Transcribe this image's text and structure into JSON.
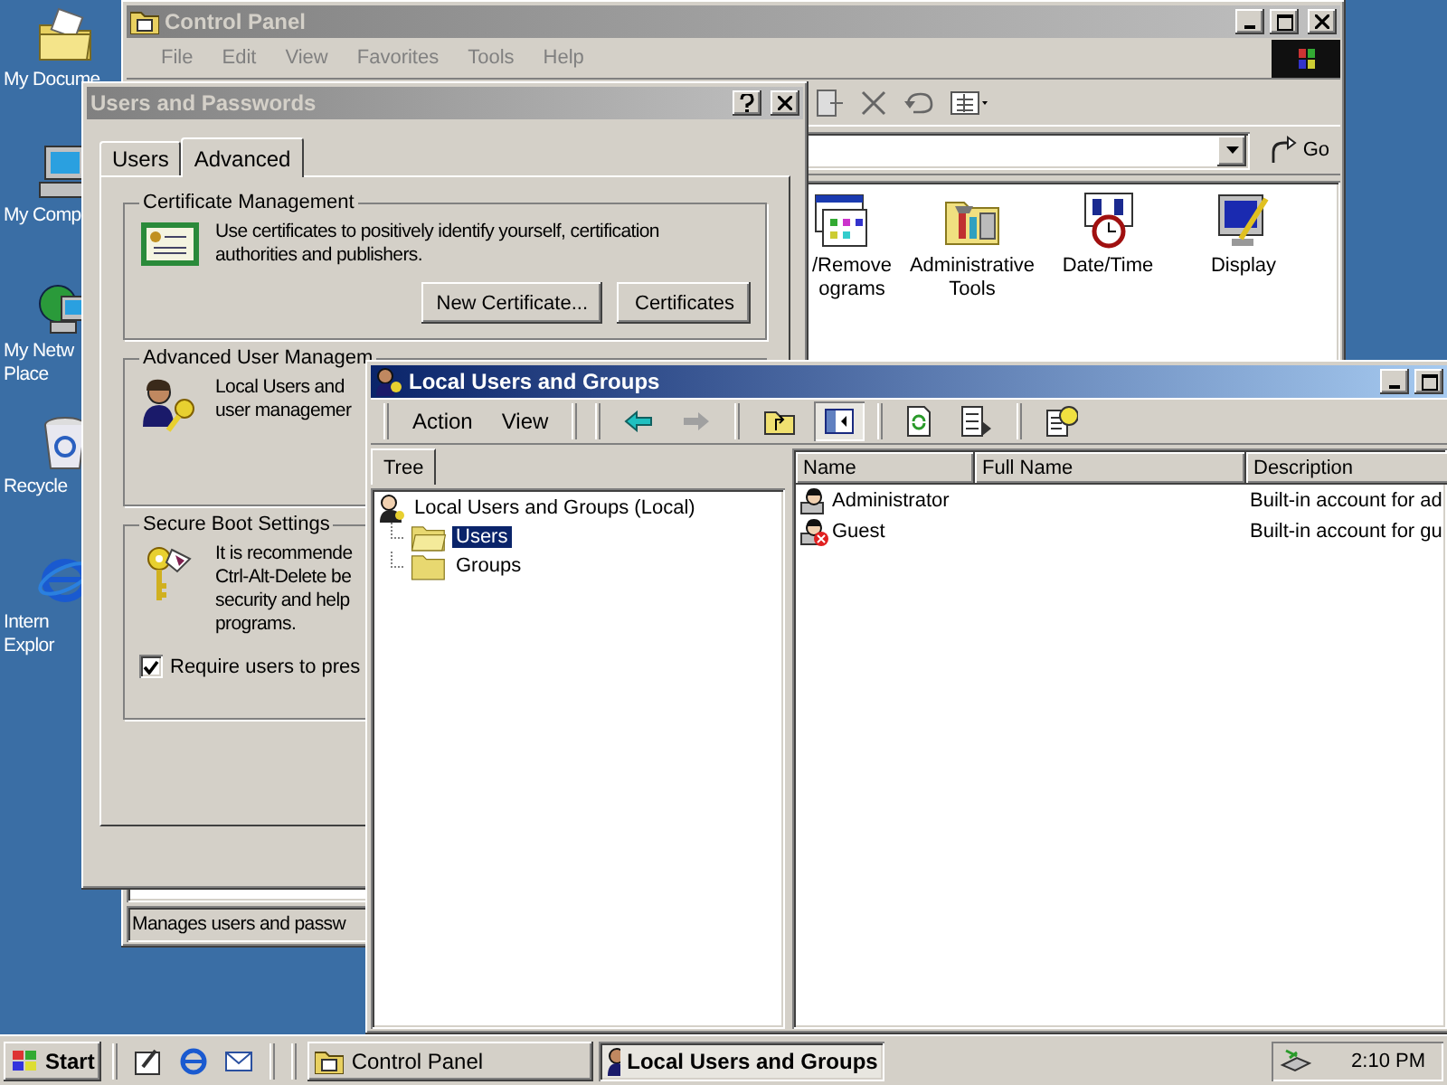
{
  "desktop_icons": [
    {
      "label_lines": [
        "My Docume"
      ]
    },
    {
      "label_lines": [
        "My Comp"
      ]
    },
    {
      "label_lines": [
        "My Netw",
        "Place"
      ]
    },
    {
      "label_lines": [
        "Recycle"
      ]
    },
    {
      "label_lines": [
        "Intern",
        "Explor"
      ]
    }
  ],
  "control_panel": {
    "title": "Control Panel",
    "active": false,
    "menu": [
      "File",
      "Edit",
      "View",
      "Favorites",
      "Tools",
      "Help"
    ],
    "go_button": "Go",
    "items": [
      {
        "lines": [
          "/Remove",
          "ograms"
        ]
      },
      {
        "lines": [
          "Administrative",
          "Tools"
        ]
      },
      {
        "lines": [
          "Date/Time"
        ]
      },
      {
        "lines": [
          "Display"
        ]
      }
    ],
    "status_bar": "Manages users and passw"
  },
  "users_and_passwords": {
    "title": "Users and Passwords",
    "active": false,
    "tabs": [
      {
        "label": "Users",
        "selected": false
      },
      {
        "label": "Advanced",
        "selected": true
      }
    ],
    "certificate_management": {
      "legend": "Certificate Management",
      "description_lines": [
        "Use certificates to positively identify yourself, certification",
        "authorities and publishers."
      ],
      "buttons": [
        "New Certificate...",
        "Certificates"
      ]
    },
    "advanced_user_management": {
      "legend": "Advanced User Managem",
      "description_lines": [
        "Local Users and",
        "user managemer"
      ]
    },
    "secure_boot": {
      "legend": "Secure Boot Settings",
      "description_lines": [
        "It is recommende",
        "Ctrl-Alt-Delete be",
        "security and help",
        "programs."
      ],
      "checkbox": {
        "label": "Require users to pres",
        "checked": true
      }
    }
  },
  "local_users_and_groups": {
    "title": "Local Users and Groups",
    "active": true,
    "menu": [
      "Action",
      "View"
    ],
    "tree_tab": "Tree",
    "tree": [
      {
        "label": "Local Users and Groups (Local)",
        "expanded": true,
        "selected": false,
        "children": [
          {
            "label": "Users",
            "selected": true
          },
          {
            "label": "Groups",
            "selected": false
          }
        ]
      }
    ],
    "columns": [
      "Name",
      "Full Name",
      "Description"
    ],
    "rows": [
      {
        "name": "Administrator",
        "description": "Built-in account for ad",
        "disabled": false
      },
      {
        "name": "Guest",
        "description": "Built-in account for gu",
        "disabled": true
      }
    ]
  },
  "taskbar": {
    "start": "Start",
    "buttons": [
      {
        "label": "Control Panel",
        "selected": false
      },
      {
        "label": "Local Users and Groups",
        "selected": true
      }
    ],
    "clock": "2:10 PM"
  }
}
